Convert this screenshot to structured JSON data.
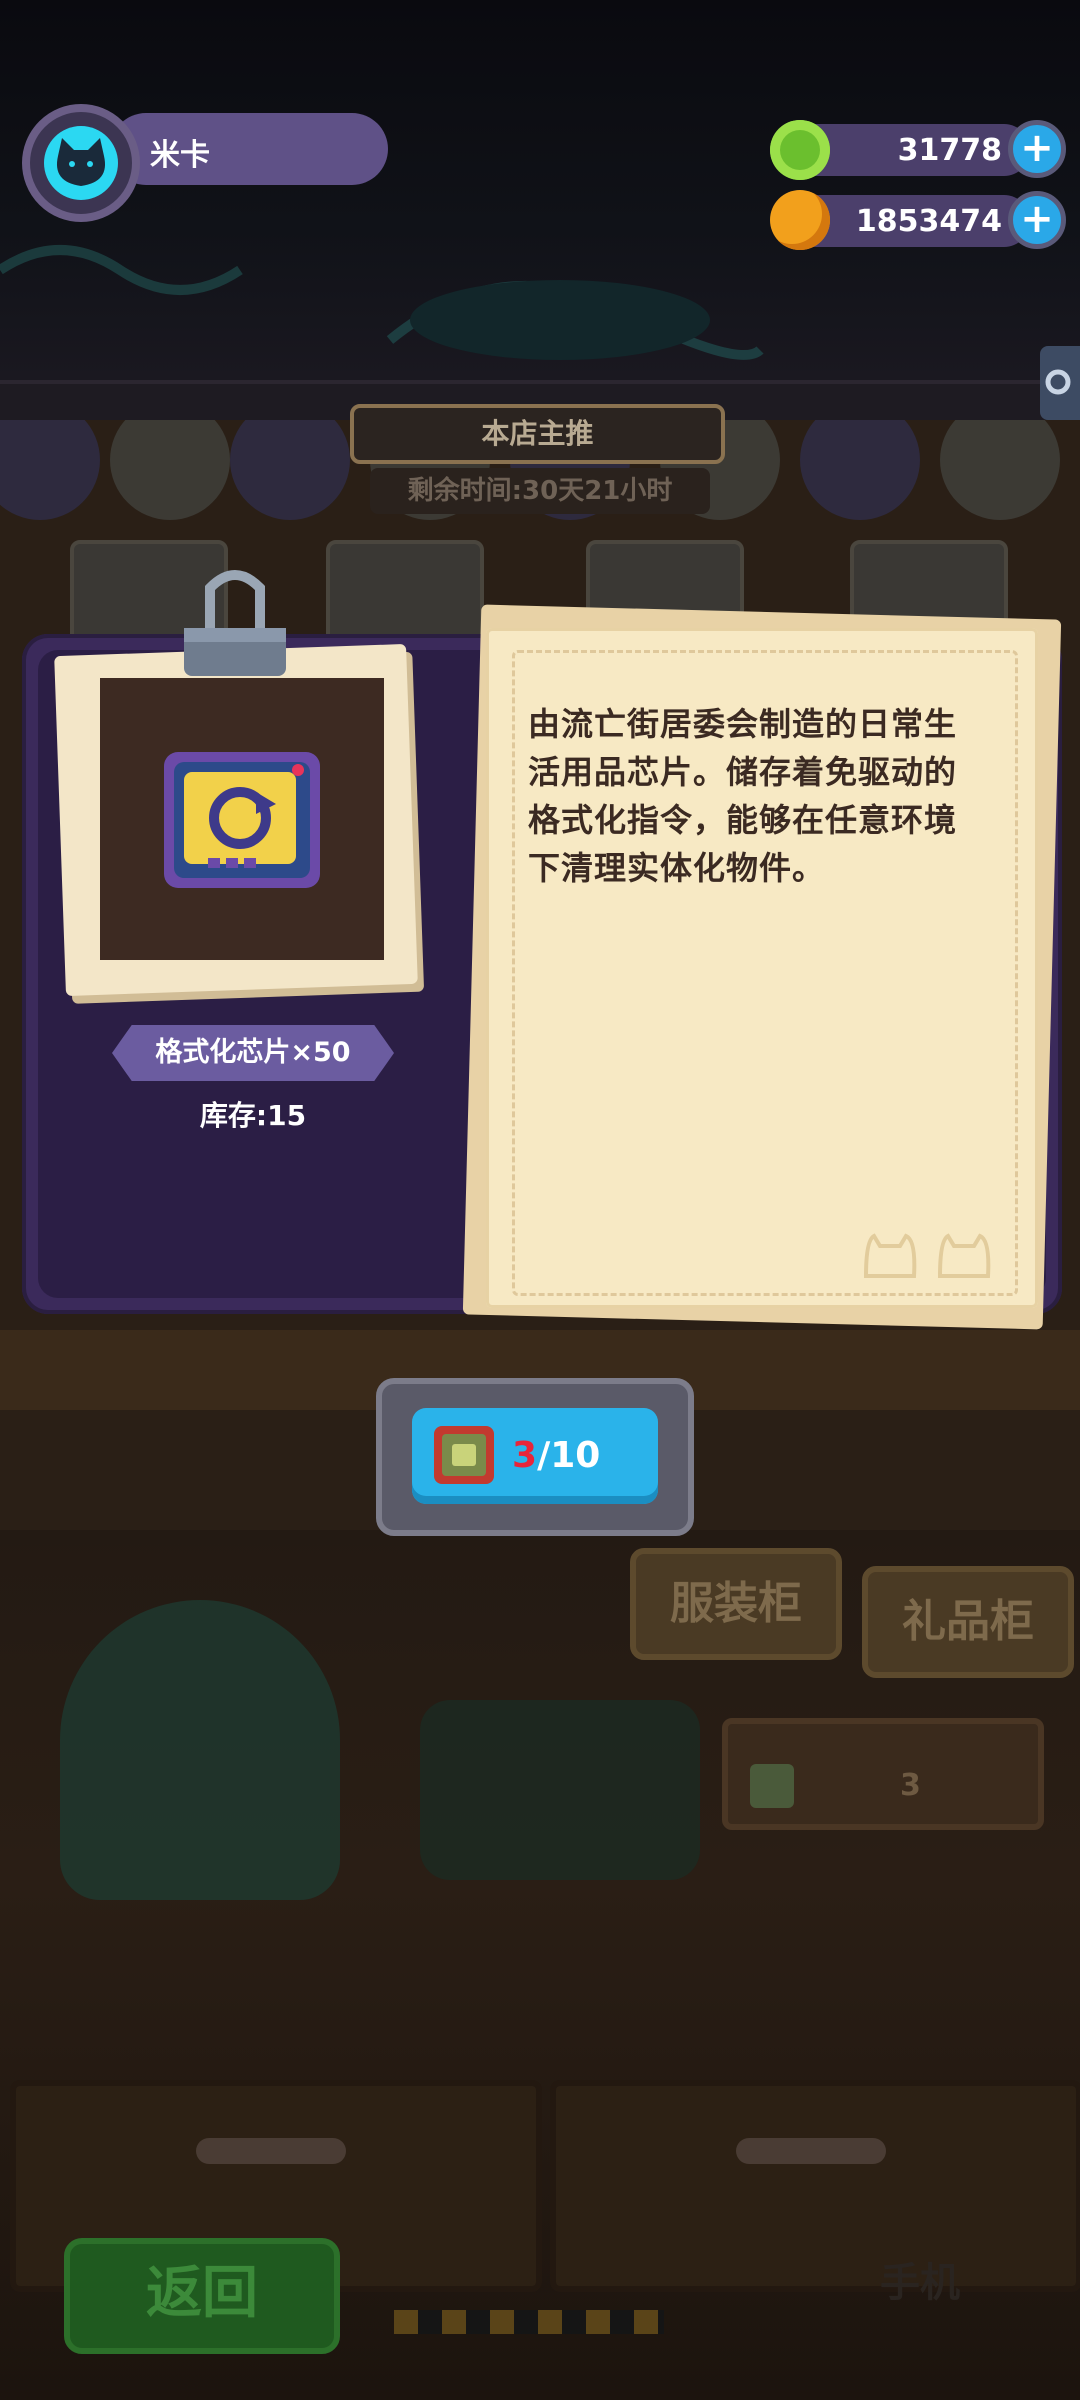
{
  "player": {
    "name": "米卡"
  },
  "currencies": [
    {
      "icon": "green-gem-icon",
      "value": "31778"
    },
    {
      "icon": "planet-coin-icon",
      "value": "1853474"
    }
  ],
  "banner": {
    "title": "本店主推",
    "remaining": "剩余时间:30天21小时"
  },
  "item": {
    "name": "格式化芯片×50",
    "stock": "库存:15",
    "description": "由流亡街居委会制造的日常生活用品芯片。储存着免驱动的格式化指令，能够在任意环境下清理实体化物件。"
  },
  "progress": {
    "current": "3",
    "separator": "/",
    "total": "10"
  },
  "background": {
    "cabinet_clothing": "服装柜",
    "cabinet_gift": "礼品柜",
    "shelf_count": "3",
    "back_button": "返回",
    "corner_label": "手机"
  },
  "colors": {
    "accent": "#2ab3ea",
    "dialog": "#3b2a5b",
    "paper": "#f7e9c4",
    "highlight": "#e8253a"
  }
}
